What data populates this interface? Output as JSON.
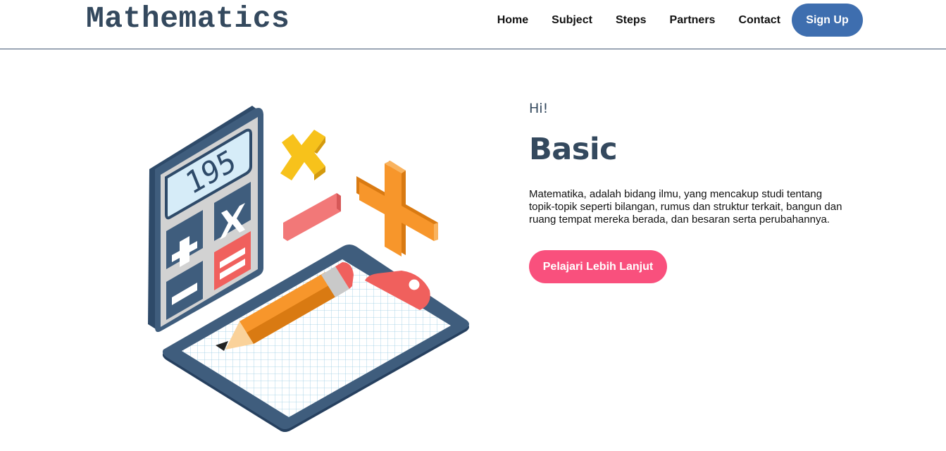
{
  "brand": {
    "title": "Mathematics"
  },
  "nav": {
    "items": [
      {
        "label": "Home"
      },
      {
        "label": "Subject"
      },
      {
        "label": "Steps"
      },
      {
        "label": "Partners"
      },
      {
        "label": "Contact"
      }
    ],
    "signup_label": "Sign Up"
  },
  "hero": {
    "calculator_display": "195",
    "greeting": "Hi!",
    "title": "Basic",
    "description": "Matematika, adalah bidang ilmu, yang mencakup studi tentang topik-topik seperti bilangan, rumus dan struktur terkait, bangun dan ruang tempat mereka berada, dan besaran serta perubahannya.",
    "cta_label": "Pelajari Lebih Lanjut"
  },
  "colors": {
    "brand_text": "#34495e",
    "nav_border": "#3e5470",
    "signup_bg": "#3e6eaf",
    "cta_bg": "#f9507d"
  }
}
